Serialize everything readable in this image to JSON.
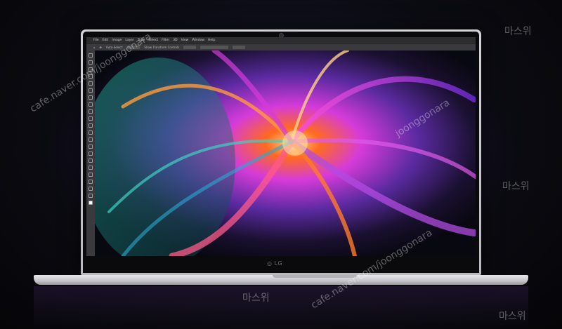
{
  "app_menu": [
    "File",
    "Edit",
    "Image",
    "Layer",
    "Type",
    "Select",
    "Filter",
    "3D",
    "View",
    "Window",
    "Help"
  ],
  "options": {
    "auto_select": "Auto-Select:",
    "layer": "Layer",
    "transform": "Show Transform Controls"
  },
  "brand": "LG",
  "watermarks": {
    "korean": "마스위",
    "site1": "cafe.naver.com/joonggonara",
    "site2": "joonggonara"
  },
  "colors": {
    "accent_magenta": "#d63bd9",
    "accent_orange": "#ff6a1f",
    "accent_teal": "#26c2a8"
  }
}
